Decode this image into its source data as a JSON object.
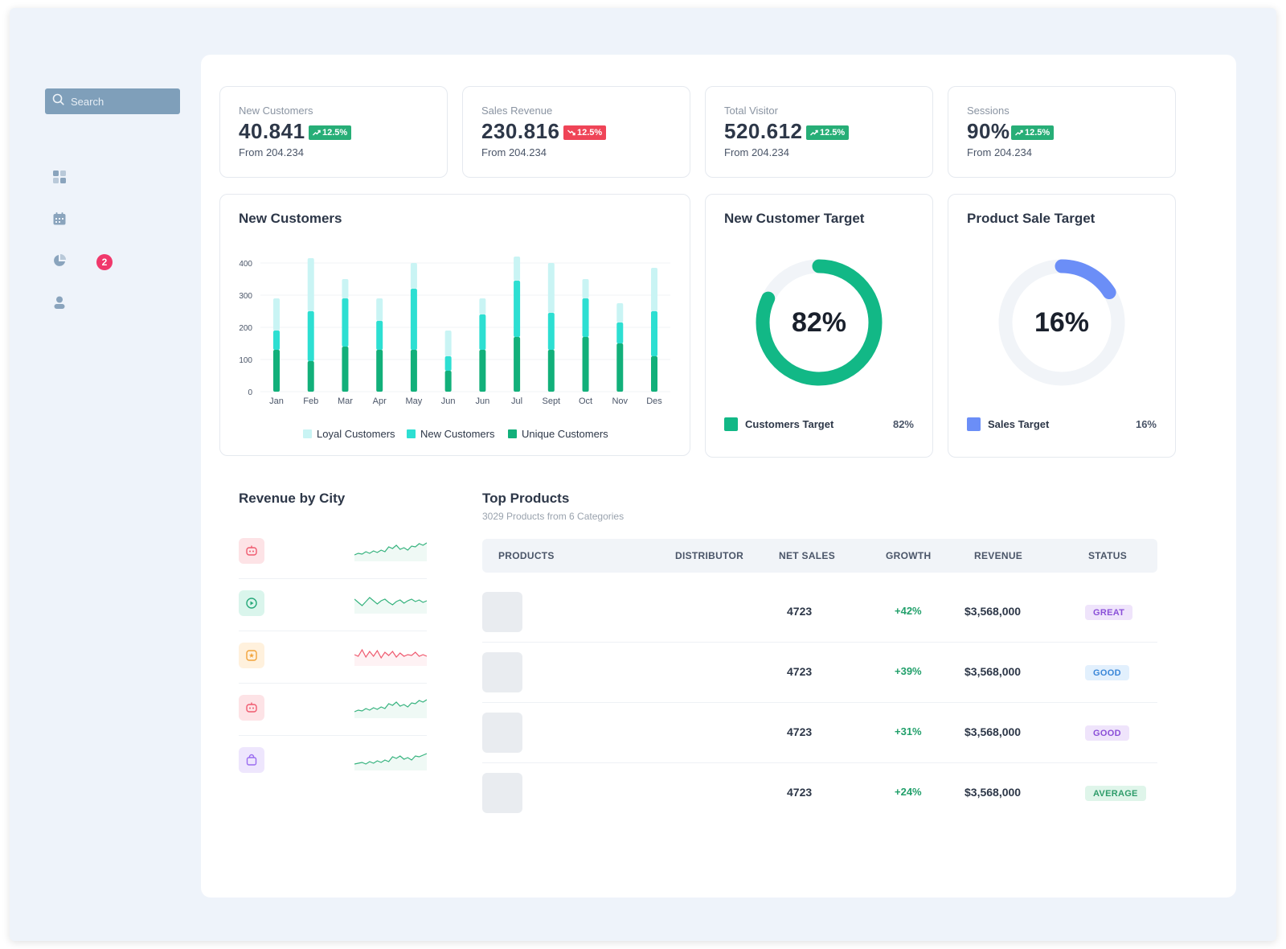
{
  "search": {
    "placeholder": "Search"
  },
  "sidebar": {
    "items": [
      {
        "icon": "dashboard-icon"
      },
      {
        "icon": "calendar-icon"
      },
      {
        "icon": "pie-chart-icon",
        "badge": "2"
      },
      {
        "icon": "user-icon"
      }
    ]
  },
  "stats": [
    {
      "label": "New Customers",
      "value": "40.841",
      "change": "12.5%",
      "trend": "up",
      "sub": "From 204.234"
    },
    {
      "label": "Sales Revenue",
      "value": "230.816",
      "change": "12.5%",
      "trend": "down",
      "sub": "From 204.234"
    },
    {
      "label": "Total Visitor",
      "value": "520.612",
      "change": "12.5%",
      "trend": "up",
      "sub": "From 204.234"
    },
    {
      "label": "Sessions",
      "value": "90%",
      "change": "12.5%",
      "trend": "up",
      "sub": "From 204.234"
    }
  ],
  "colors": {
    "up": "#27ae77",
    "down": "#ef4457",
    "loyal": "#c9f4f4",
    "new": "#2ddfd2",
    "unique": "#12b07a",
    "customer_target": "#12b886",
    "sales_target": "#6b8ef7",
    "track": "#f1f4f8"
  },
  "new_customers_chart": {
    "title": "New Customers",
    "legend": [
      "Loyal Customers",
      "New Customers",
      "Unique Customers"
    ]
  },
  "chart_data": {
    "type": "bar",
    "title": "New Customers",
    "categories": [
      "Jan",
      "Feb",
      "Mar",
      "Apr",
      "May",
      "Jun",
      "Jun",
      "Jul",
      "Sept",
      "Oct",
      "Nov",
      "Des"
    ],
    "series": [
      {
        "name": "Unique Customers",
        "values": [
          130,
          95,
          140,
          130,
          130,
          65,
          130,
          170,
          130,
          170,
          150,
          110
        ]
      },
      {
        "name": "New Customers",
        "values": [
          60,
          155,
          150,
          90,
          190,
          45,
          110,
          175,
          115,
          120,
          65,
          140
        ]
      },
      {
        "name": "Loyal Customers",
        "values": [
          100,
          165,
          60,
          70,
          80,
          80,
          50,
          75,
          155,
          60,
          60,
          135
        ]
      }
    ],
    "stacked": true,
    "yticks": [
      0,
      100,
      200,
      300,
      400
    ],
    "ylim": [
      0,
      420
    ],
    "legend_position": "bottom",
    "grid": true
  },
  "customer_target": {
    "title": "New Customer Target",
    "value": 82,
    "center": "82%",
    "legend": "Customers Target",
    "pct": "82%"
  },
  "sales_target": {
    "title": "Product Sale Target",
    "value": 16,
    "center": "16%",
    "legend": "Sales Target",
    "pct": "16%"
  },
  "revenue_by_city": {
    "title": "Revenue by City",
    "rows": [
      {
        "icon": "robot-icon",
        "bg": "#fde3e6",
        "fg": "#ef5a6f",
        "line": "#36b37e"
      },
      {
        "icon": "play-icon",
        "bg": "#daf5ec",
        "fg": "#26a879",
        "line": "#36b37e"
      },
      {
        "icon": "star-icon",
        "bg": "#fff1dd",
        "fg": "#f2a33a",
        "line": "#ef5a6f"
      },
      {
        "icon": "robot-icon",
        "bg": "#fde3e6",
        "fg": "#ef5a6f",
        "line": "#36b37e"
      },
      {
        "icon": "bag-icon",
        "bg": "#eee6fd",
        "fg": "#9a6cf0",
        "line": "#36b37e"
      }
    ]
  },
  "top_products": {
    "title": "Top Products",
    "subtitle": "3029 Products from 6 Categories",
    "headers": [
      "PRODUCTS",
      "DISTRIBUTOR",
      "NET SALES",
      "GROWTH",
      "REVENUE",
      "STATUS"
    ],
    "rows": [
      {
        "net_sales": "4723",
        "growth": "+42%",
        "revenue": "$3,568,000",
        "status": "GREAT",
        "status_bg": "#efe4fb",
        "status_fg": "#8a4fd8"
      },
      {
        "net_sales": "4723",
        "growth": "+39%",
        "revenue": "$3,568,000",
        "status": "GOOD",
        "status_bg": "#e2f0fd",
        "status_fg": "#3a86d8"
      },
      {
        "net_sales": "4723",
        "growth": "+31%",
        "revenue": "$3,568,000",
        "status": "GOOD",
        "status_bg": "#efe4fb",
        "status_fg": "#8a4fd8"
      },
      {
        "net_sales": "4723",
        "growth": "+24%",
        "revenue": "$3,568,000",
        "status": "AVERAGE",
        "status_bg": "#dff5ea",
        "status_fg": "#2e9c6a"
      }
    ]
  }
}
